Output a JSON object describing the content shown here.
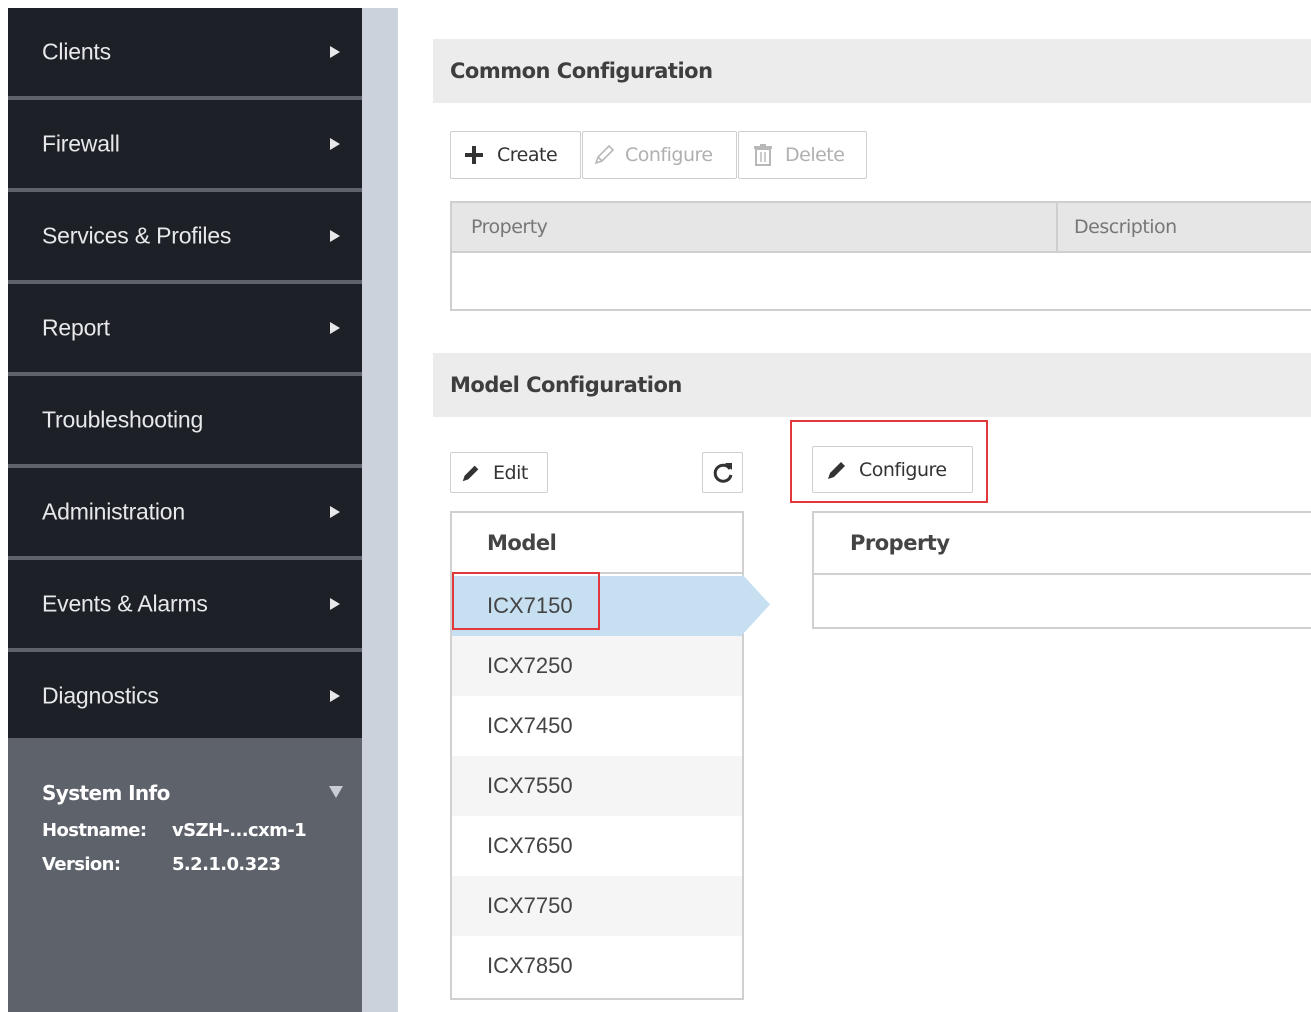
{
  "sidebar": {
    "items": [
      {
        "label": "Clients",
        "has_arrow": true
      },
      {
        "label": "Firewall",
        "has_arrow": true
      },
      {
        "label": "Services & Profiles",
        "has_arrow": true
      },
      {
        "label": "Report",
        "has_arrow": true
      },
      {
        "label": "Troubleshooting",
        "has_arrow": false
      },
      {
        "label": "Administration",
        "has_arrow": true
      },
      {
        "label": "Events & Alarms",
        "has_arrow": true
      },
      {
        "label": "Diagnostics",
        "has_arrow": true
      }
    ],
    "system_info": {
      "title": "System Info",
      "hostname_label": "Hostname:",
      "hostname_value": "vSZH-...cxm-1",
      "version_label": "Version:",
      "version_value": "5.2.1.0.323"
    }
  },
  "common_config": {
    "title": "Common Configuration",
    "toolbar": {
      "create_label": "Create",
      "configure_label": "Configure",
      "delete_label": "Delete"
    },
    "table": {
      "columns": [
        "Property",
        "Description"
      ]
    }
  },
  "model_config": {
    "title": "Model Configuration",
    "edit_label": "Edit",
    "configure_label": "Configure",
    "models_header": "Model",
    "models": [
      "ICX7150",
      "ICX7250",
      "ICX7450",
      "ICX7550",
      "ICX7650",
      "ICX7750",
      "ICX7850"
    ],
    "selected_model": "ICX7150",
    "property_header": "Property"
  },
  "colors": {
    "sidebar_bg": "#1d2026",
    "sysinfo_bg": "#5d626b",
    "gutter_bg": "#cbd2dc",
    "selected_row": "#c6dff1",
    "highlight_box": "#e2383c"
  }
}
